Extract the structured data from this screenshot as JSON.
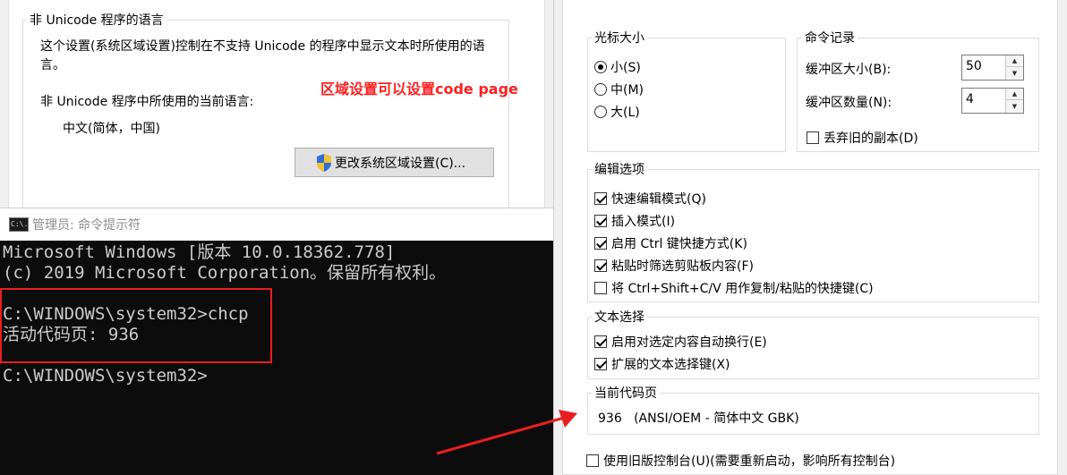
{
  "region": {
    "group_title": "非 Unicode 程序的语言",
    "description": "这个设置(系统区域设置)控制在不支持 Unicode 的程序中显示文本时所使用的语言。",
    "current_label": "非 Unicode 程序中所使用的当前语言:",
    "current_value": "中文(简体，中国)",
    "annotation": "区域设置可以设置code page",
    "change_button": "更改系统区域设置(C)..."
  },
  "cmd": {
    "title": "管理员: 命令提示符",
    "icon_text": "C:\\.",
    "lines": [
      "Microsoft Windows [版本 10.0.18362.778]",
      "(c) 2019 Microsoft Corporation。保留所有权利。",
      "",
      "C:\\WINDOWS\\system32>chcp",
      "活动代码页: 936",
      "",
      "C:\\WINDOWS\\system32>"
    ]
  },
  "props": {
    "cursor": {
      "title": "光标大小",
      "options": [
        "小(S)",
        "中(M)",
        "大(L)"
      ],
      "selected": 0
    },
    "history": {
      "title": "命令记录",
      "buffer_size_label": "缓冲区大小(B):",
      "buffer_size": "50",
      "buffer_count_label": "缓冲区数量(N):",
      "buffer_count": "4",
      "discard_label": "丢弃旧的副本(D)",
      "discard_checked": false
    },
    "edit": {
      "title": "编辑选项",
      "items": [
        {
          "label": "快速编辑模式(Q)",
          "checked": true
        },
        {
          "label": "插入模式(I)",
          "checked": true
        },
        {
          "label": "启用 Ctrl 键快捷方式(K)",
          "checked": true
        },
        {
          "label": "粘贴时筛选剪贴板内容(F)",
          "checked": true
        },
        {
          "label": "将 Ctrl+Shift+C/V 用作复制/粘贴的快捷键(C)",
          "checked": false
        }
      ]
    },
    "text_select": {
      "title": "文本选择",
      "items": [
        {
          "label": "启用对选定内容自动换行(E)",
          "checked": true
        },
        {
          "label": "扩展的文本选择键(X)",
          "checked": true
        }
      ]
    },
    "codepage": {
      "title": "当前代码页",
      "value": "936   (ANSI/OEM - 简体中文 GBK)"
    },
    "legacy": {
      "label": "使用旧版控制台(U)(需要重新启动，影响所有控制台)",
      "checked": false
    }
  },
  "colors": {
    "annotation": "#ff1f1f",
    "cmd_background": "#0c0c0c",
    "cmd_text": "#cccccc"
  }
}
